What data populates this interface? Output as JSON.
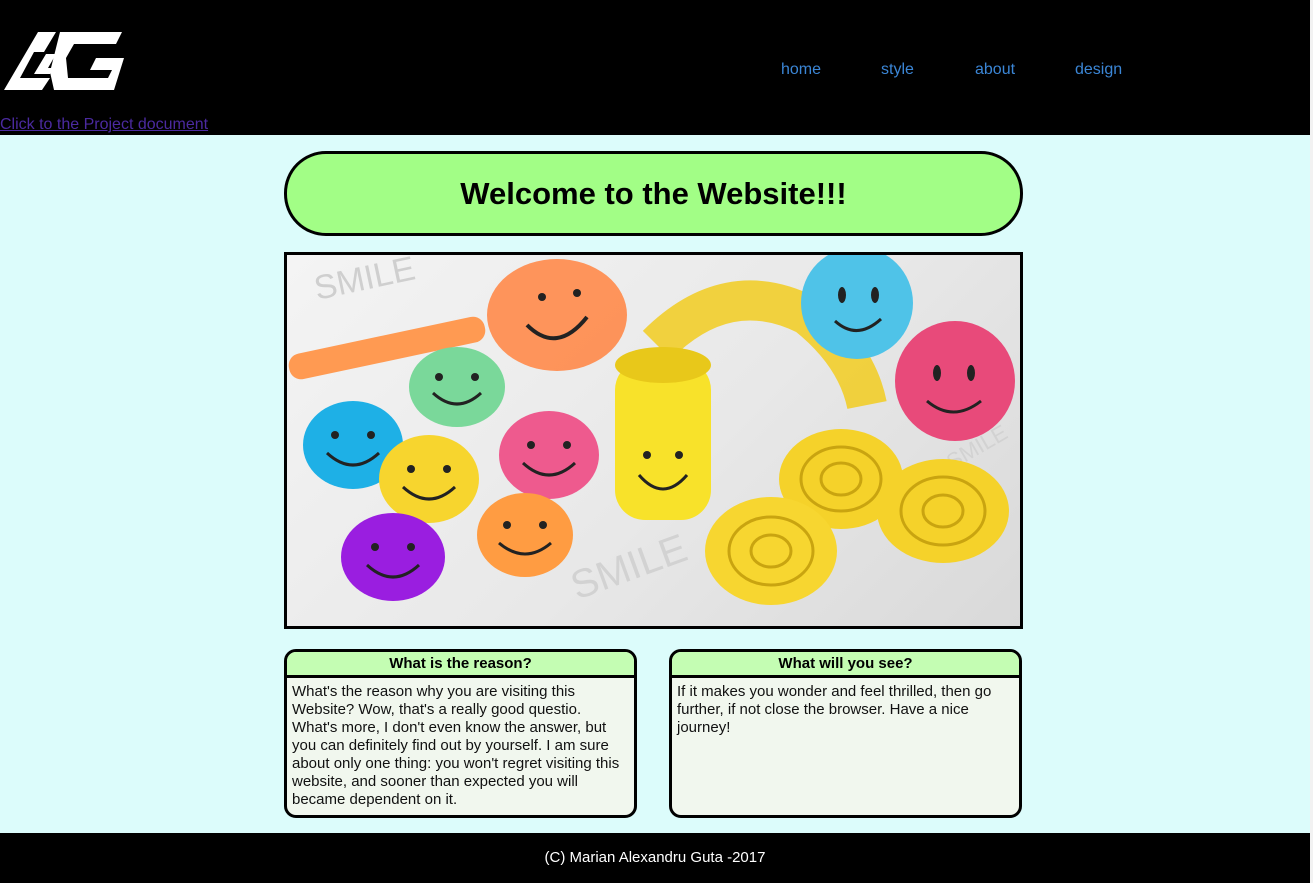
{
  "header": {
    "logo_alt": "AG",
    "nav": [
      {
        "label": "home"
      },
      {
        "label": "style"
      },
      {
        "label": "about"
      },
      {
        "label": "design"
      }
    ],
    "project_link": "Click to the Project document"
  },
  "main": {
    "welcome_title": "Welcome to the Website!!!",
    "hero_image": "smiley-toys-image",
    "boxes": [
      {
        "title": "What is the reason?",
        "text": "What's the reason why you are visiting this Website? Wow, that's a really good questio. What's more, I don't even know the answer, but you can definitely find out by yourself. I am sure about only one thing: you won't regret visiting this website, and sooner than expected you will became dependent on it."
      },
      {
        "title": "What will you see?",
        "text": "If it makes you wonder and feel thrilled, then go further, if not close the browser. Have a nice journey!"
      }
    ]
  },
  "footer": {
    "text": "(C) Marian Alexandru Guta -2017"
  },
  "colors": {
    "page_background": "#dcfcfb",
    "header_background": "#000000",
    "nav_link": "#3b86d6",
    "welcome_background": "#a2fe86",
    "box_header": "#c4fdb3",
    "box_body": "#f1f7ee"
  }
}
